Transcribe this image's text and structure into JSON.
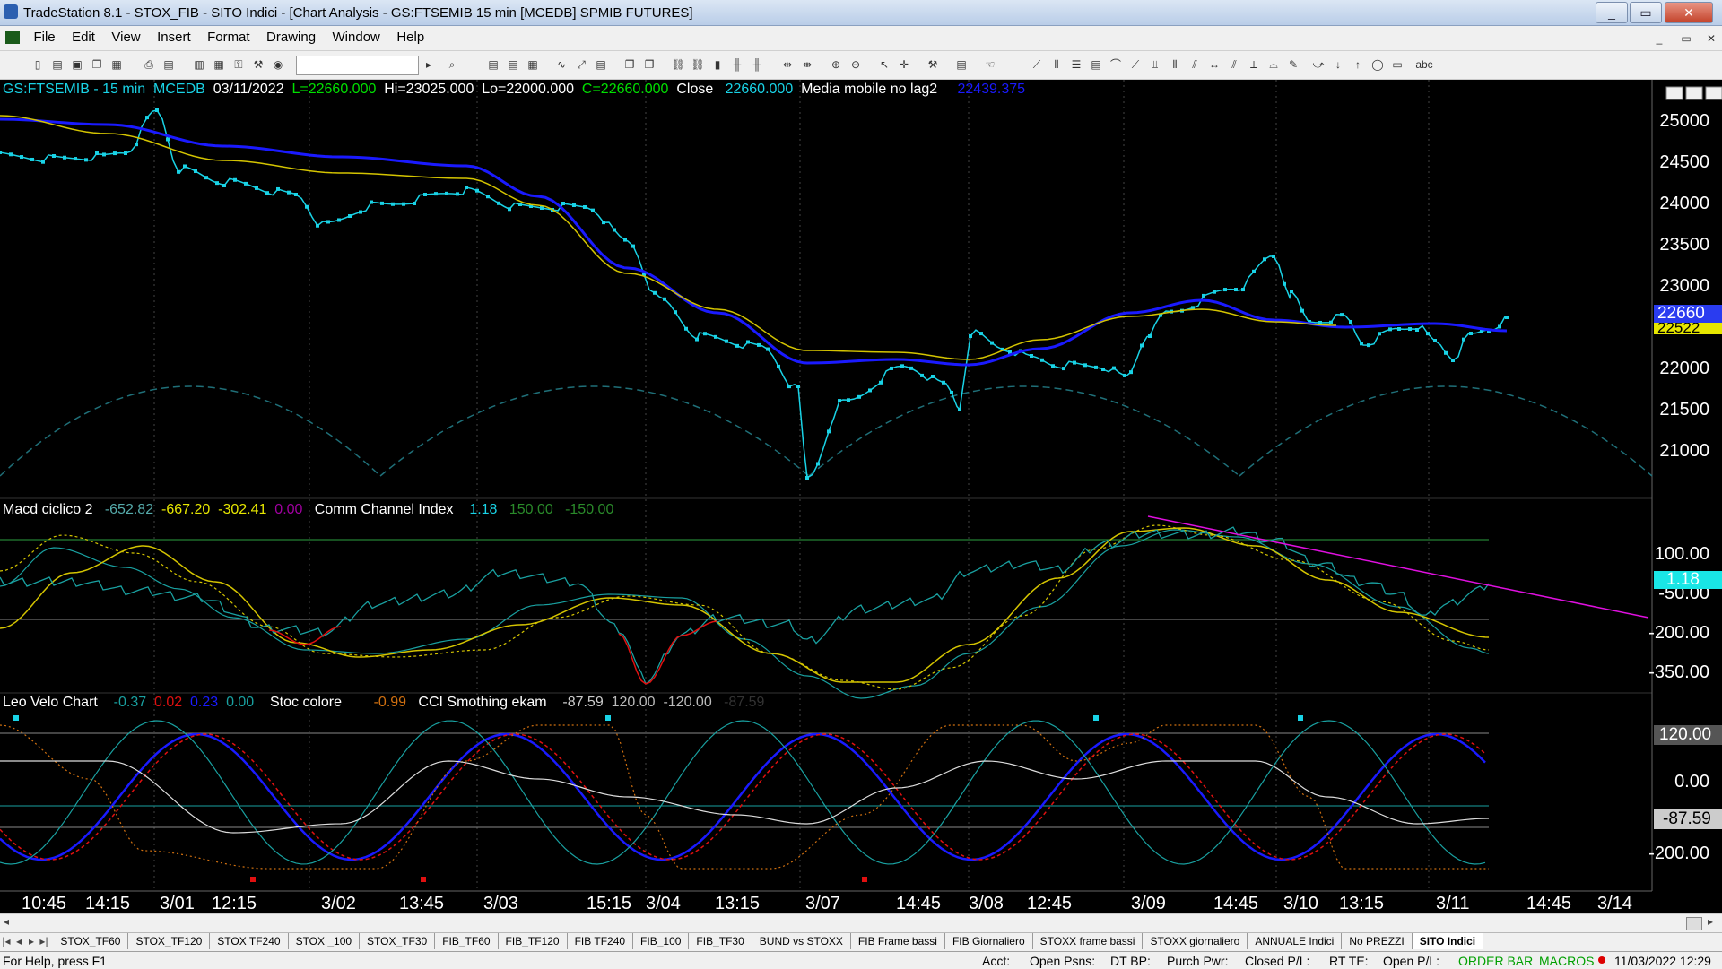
{
  "window": {
    "title": "TradeStation 8.1 - STOX_FIB - SITO Indici - [Chart Analysis - GS:FTSEMIB  15 min  [MCEDB] SPMIB FUTURES]",
    "minimize": "_",
    "restore": "▭",
    "close": "✕"
  },
  "menu": [
    "File",
    "Edit",
    "View",
    "Insert",
    "Format",
    "Drawing",
    "Window",
    "Help"
  ],
  "chart": {
    "price_header": {
      "symbol": "GS:FTSEMIB - 15 min",
      "source": "MCEDB",
      "date": "03/11/2022",
      "low": "L=22660.000",
      "hi": "Hi=23025.000",
      "lo": "Lo=22000.000",
      "close": "C=22660.000",
      "close_lbl": "Close",
      "close_val": "22660.000",
      "ma_lbl": "Media mobile no lag2",
      "ma_val": "22439.375"
    },
    "price_axis": [
      "25000",
      "24500",
      "24000",
      "23500",
      "23000",
      "22000",
      "21500",
      "21000"
    ],
    "price_last": "22660",
    "price_ma": "22522",
    "macd_header": {
      "name": "Macd ciclico 2",
      "v1": "-652.82",
      "v2": "-667.20",
      "v3": "-302.41",
      "v4": "0.00",
      "cci_lbl": "Comm Channel Index",
      "c1": "1.18",
      "c2": "150.00",
      "c3": "-150.00"
    },
    "macd_axis": [
      "100.00",
      "-50.00",
      "-200.00",
      "-350.00"
    ],
    "macd_last": "1.18",
    "leo_header": {
      "name": "Leo Velo Chart",
      "v1": "-0.37",
      "v2": "0.02",
      "v3": "0.23",
      "v4": "0.00",
      "stoc_lbl": "Stoc colore",
      "s1": "-0.99",
      "cci_lbl": "CCI Smothing ekam",
      "c1": "-87.59",
      "c2": "120.00",
      "c3": "-120.00",
      "c4": "-87.59"
    },
    "leo_axis": [
      "0.00",
      "-200.00"
    ],
    "leo_top": "120.00",
    "leo_last": "-87.59",
    "time_axis": [
      "10:45",
      "14:15",
      "3/01",
      "12:15",
      "3/02",
      "13:45",
      "3/03",
      "15:15",
      "3/04",
      "13:15",
      "3/07",
      "14:45",
      "3/08",
      "12:45",
      "3/09",
      "14:45",
      "3/10",
      "13:15",
      "3/11",
      "14:45",
      "3/14"
    ]
  },
  "tabs": [
    "STOX_TF60",
    "STOX_TF120",
    "STOX TF240",
    "STOX _100",
    "STOX_TF30",
    "FIB_TF60",
    "FIB_TF120",
    "FIB TF240",
    "FIB_100",
    "FIB_TF30",
    "BUND vs STOXX",
    "FIB Frame bassi",
    "FIB Giornaliero",
    "STOXX frame bassi",
    "STOXX giornaliero",
    "ANNUALE Indici",
    "No PREZZI",
    "SITO Indici"
  ],
  "status": {
    "help": "For Help, press F1",
    "acct": "Acct:",
    "open_psns": "Open Psns:",
    "dt_bp": "DT BP:",
    "purch": "Purch Pwr:",
    "closed": "Closed P/L:",
    "rt_te": "RT TE:",
    "open_pl": "Open P/L:",
    "order_bar": "ORDER BAR",
    "macros": "MACROS",
    "datetime": "11/03/2022 12:29"
  },
  "colors": {
    "price": "#19d3e6",
    "ma_blue": "#1a1aff",
    "ma_yellow": "#d4c400",
    "magenta": "#e010e0",
    "red": "#e01010"
  }
}
